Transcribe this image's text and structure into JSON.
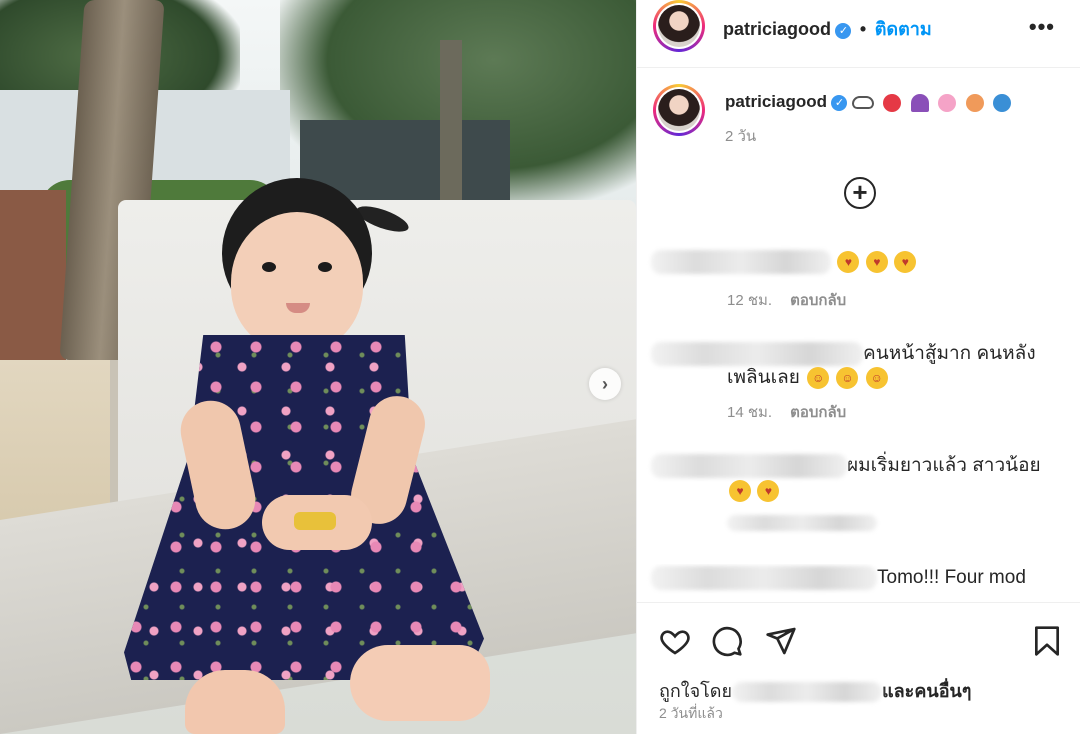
{
  "post": {
    "author": "patriciagood",
    "follow_label": "ติดตาม",
    "separator": "•",
    "more_label": "•••",
    "next_label": "›"
  },
  "caption": {
    "username": "patriciagood",
    "emojis": [
      "cloud",
      "heart",
      "umbrella",
      "cherry-blossom",
      "shell",
      "wave"
    ],
    "time": "2 วัน"
  },
  "comments": [
    {
      "text": "",
      "emojis": 3,
      "time": "12 ชม.",
      "reply": "ตอบกลับ"
    },
    {
      "text": "คนหน้าสู้มาก คนหลัง",
      "text2": "เพลินเลย",
      "emojis": 3,
      "time": "14 ชม.",
      "reply": "ตอบกลับ"
    },
    {
      "text": "ผมเริ่มยาวแล้ว สาวน้อย",
      "emojis": 2,
      "time": "",
      "reply": ""
    },
    {
      "text": "Tomo!!! Four mod",
      "text2": "......"
    }
  ],
  "actions": {
    "like": "like-icon",
    "comment": "comment-icon",
    "share": "share-icon",
    "save": "save-icon"
  },
  "likes": {
    "prefix": "ถูกใจโดย",
    "suffix": "และคนอื่นๆ"
  },
  "footer": {
    "date": "2 วันที่แล้ว"
  },
  "colors": {
    "accent": "#0095f6",
    "verified": "#3897f0",
    "meta": "#8e8e8e",
    "dress": "#1c2150"
  }
}
